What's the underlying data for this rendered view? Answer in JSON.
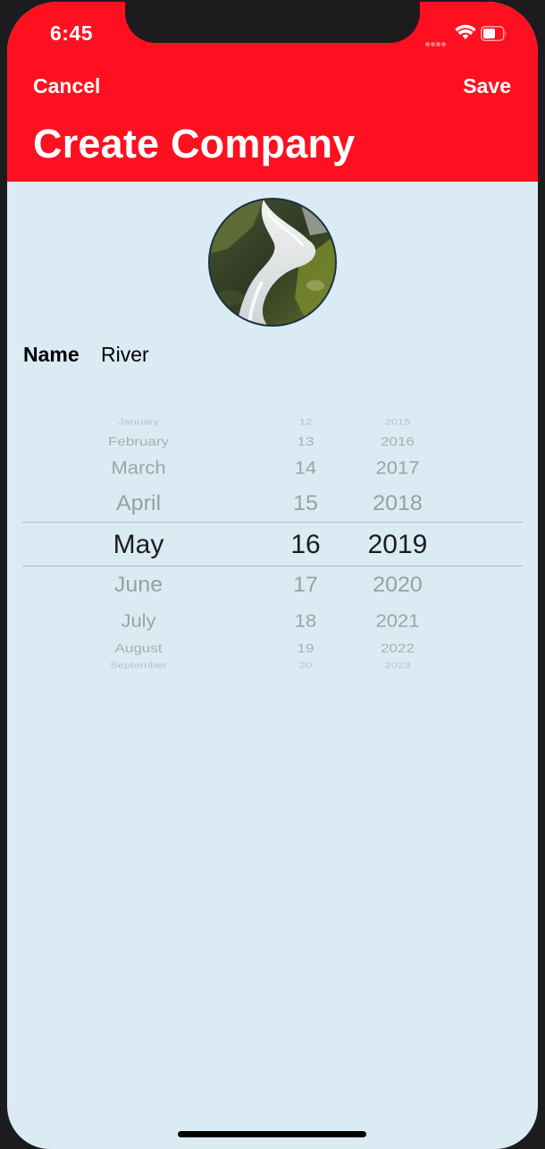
{
  "status_bar": {
    "time": "6:45"
  },
  "nav": {
    "cancel_label": "Cancel",
    "save_label": "Save",
    "title": "Create Company"
  },
  "form": {
    "name_label": "Name",
    "name_value": "River"
  },
  "date_picker": {
    "selected": {
      "month": "May",
      "day": "16",
      "year": "2019"
    },
    "months": [
      "January",
      "February",
      "March",
      "April",
      "May",
      "June",
      "July",
      "August",
      "September"
    ],
    "days": [
      "12",
      "13",
      "14",
      "15",
      "16",
      "17",
      "18",
      "19",
      "20"
    ],
    "years": [
      "2015",
      "2016",
      "2017",
      "2018",
      "2019",
      "2020",
      "2021",
      "2022",
      "2023"
    ]
  },
  "colors": {
    "header": "#fe1020",
    "background": "#dbebf3",
    "text_inactive": "#9a9fa4",
    "text_selected": "#1c1c1e"
  },
  "icons": {
    "signal": "cellular-signal-icon",
    "wifi": "wifi-icon",
    "battery": "battery-icon"
  }
}
